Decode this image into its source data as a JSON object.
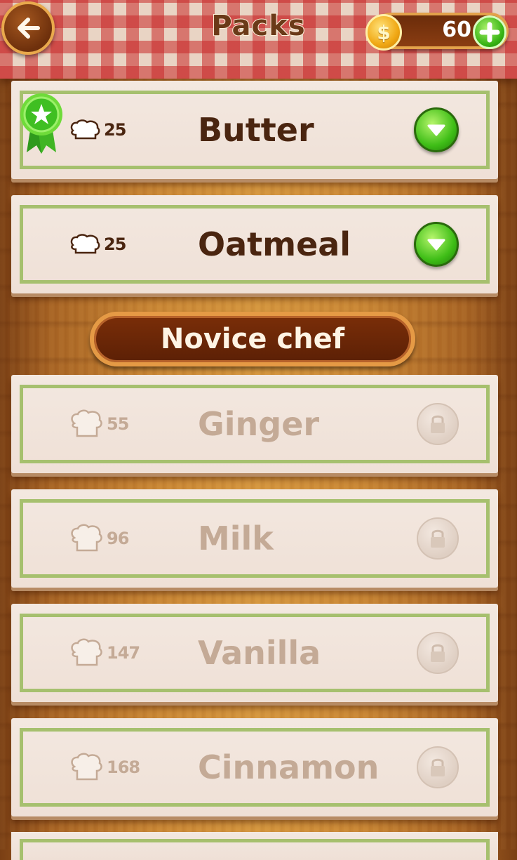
{
  "header": {
    "title": "Packs",
    "coins": "60"
  },
  "unlocked_packs": [
    {
      "name": "Butter",
      "cost": "25",
      "completed": true
    },
    {
      "name": "Oatmeal",
      "cost": "25",
      "completed": false
    }
  ],
  "section": {
    "label": "Novice chef"
  },
  "locked_packs": [
    {
      "name": "Ginger",
      "cost": "55"
    },
    {
      "name": "Milk",
      "cost": "96"
    },
    {
      "name": "Vanilla",
      "cost": "147"
    },
    {
      "name": "Cinnamon",
      "cost": "168"
    }
  ],
  "colors": {
    "frame_green": "#a6c06e",
    "text_dark": "#4a2510",
    "text_locked": "#c4aa96",
    "button_green": "#3fbe17"
  }
}
